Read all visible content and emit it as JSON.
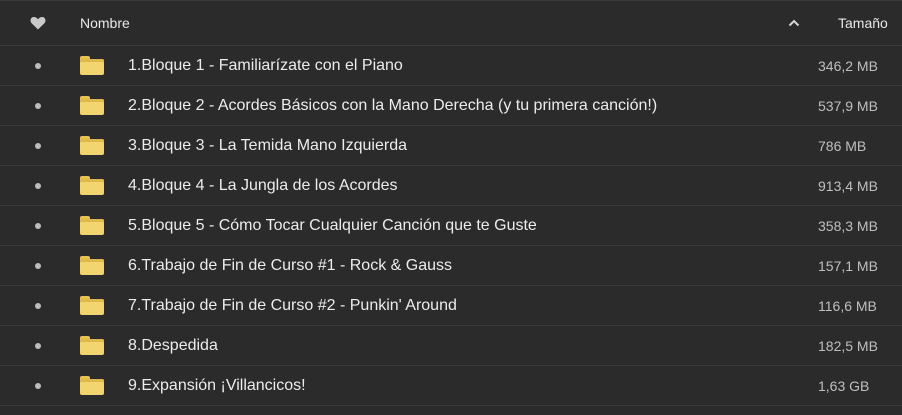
{
  "header": {
    "name_label": "Nombre",
    "size_label": "Tamaño",
    "favorite_icon": "heart-icon",
    "sort_icon": "chevron-up-icon"
  },
  "colors": {
    "background": "#2b2b2b",
    "folder": "#f3d56f",
    "text": "#ececec",
    "secondary_text": "#bfbfbf"
  },
  "files": [
    {
      "name": "1.Bloque 1 - Familiarízate con el Piano",
      "size": "346,2 MB"
    },
    {
      "name": "2.Bloque 2 - Acordes Básicos con la Mano Derecha (y tu primera canción!)",
      "size": "537,9 MB"
    },
    {
      "name": "3.Bloque 3 - La Temida Mano Izquierda",
      "size": "786 MB"
    },
    {
      "name": "4.Bloque 4 - La Jungla de los Acordes",
      "size": "913,4 MB"
    },
    {
      "name": "5.Bloque 5 - Cómo Tocar Cualquier Canción que te Guste",
      "size": "358,3 MB"
    },
    {
      "name": "6.Trabajo de Fin de Curso #1 - Rock & Gauss",
      "size": "157,1 MB"
    },
    {
      "name": "7.Trabajo de Fin de Curso #2 - Punkin' Around",
      "size": "116,6 MB"
    },
    {
      "name": "8.Despedida",
      "size": "182,5 MB"
    },
    {
      "name": "9.Expansión ¡Villancicos!",
      "size": "1,63 GB"
    }
  ]
}
